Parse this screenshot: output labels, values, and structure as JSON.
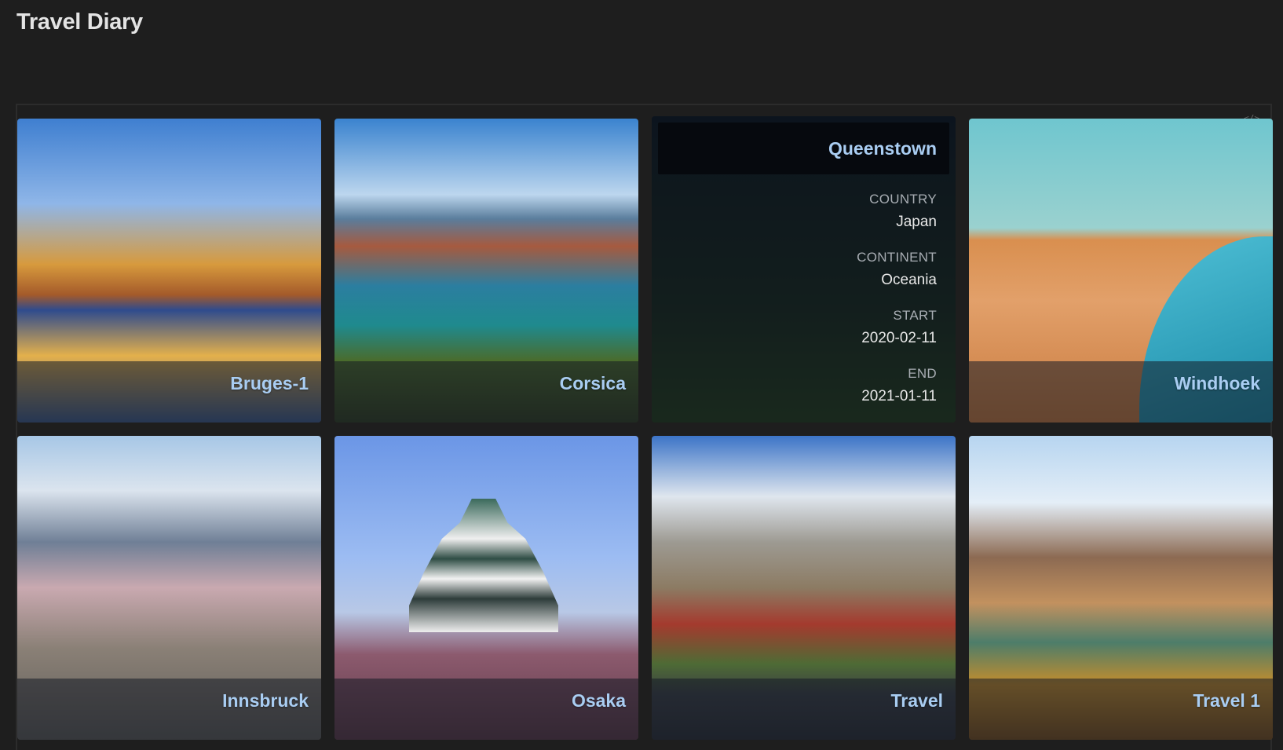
{
  "header": {
    "title": "Travel Diary"
  },
  "gallery": {
    "embed_icon": "</>",
    "cards": [
      {
        "caption": "Bruges-1"
      },
      {
        "caption": "Corsica"
      },
      {
        "caption": "Queenstown",
        "fields": [
          {
            "label": "COUNTRY",
            "value": "Japan"
          },
          {
            "label": "CONTINENT",
            "value": "Oceania"
          },
          {
            "label": "START",
            "value": "2020-02-11"
          },
          {
            "label": "END",
            "value": "2021-01-11"
          }
        ]
      },
      {
        "caption": "Windhoek"
      },
      {
        "caption": "Innsbruck"
      },
      {
        "caption": "Osaka"
      },
      {
        "caption": "Travel"
      },
      {
        "caption": "Travel 1"
      }
    ]
  }
}
